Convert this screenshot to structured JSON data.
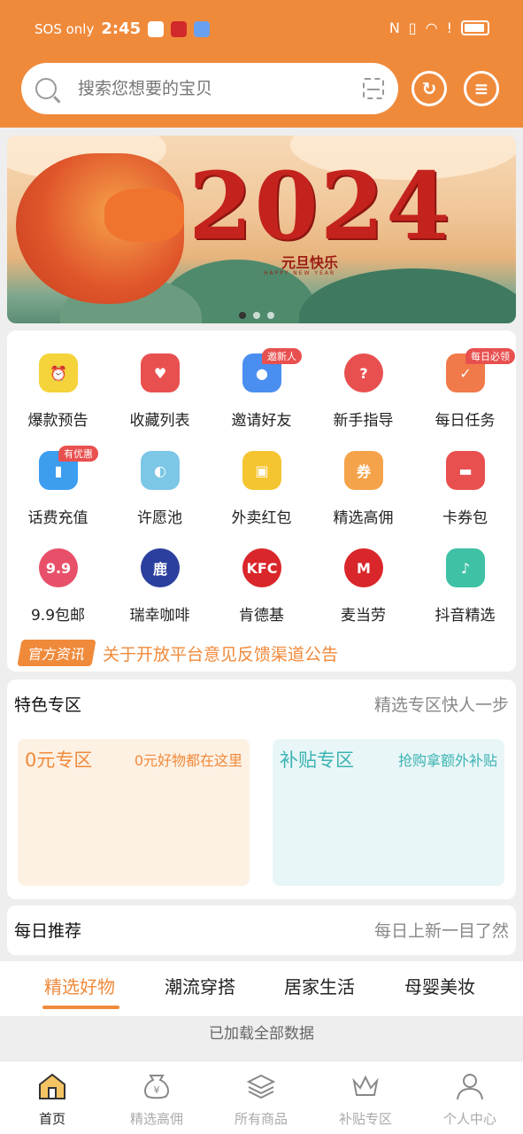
{
  "status_bar": {
    "carrier": "SOS only",
    "time": "2:45"
  },
  "search": {
    "placeholder": "搜索您想要的宝贝"
  },
  "header_icons": [
    "refresh-icon",
    "message-icon"
  ],
  "banner": {
    "year": "2024",
    "subtitle": "元旦快乐",
    "subtitle_en": "HAPPY NEW YEAR",
    "slides": 3,
    "active_slide": 1
  },
  "grid": [
    {
      "label": "爆款预告",
      "icon": "alarm-clock-icon",
      "color": "#f5d33a"
    },
    {
      "label": "收藏列表",
      "icon": "heart-icon",
      "color": "#e8504f"
    },
    {
      "label": "邀请好友",
      "icon": "user-icon",
      "color": "#4a8ef0",
      "badge": "邀新人"
    },
    {
      "label": "新手指导",
      "icon": "question-icon",
      "color": "#e8504f"
    },
    {
      "label": "每日任务",
      "icon": "calendar-check-icon",
      "color": "#f07a4a",
      "badge": "每日必领"
    },
    {
      "label": "话费充值",
      "icon": "phone-icon",
      "color": "#3d9ef0",
      "badge": "有优惠"
    },
    {
      "label": "许愿池",
      "icon": "wish-bottle-icon",
      "color": "#7cc6e6"
    },
    {
      "label": "外卖红包",
      "icon": "delivery-icon",
      "color": "#f5c531"
    },
    {
      "label": "精选高佣",
      "icon": "coupon-icon",
      "color": "#f5a34a"
    },
    {
      "label": "卡券包",
      "icon": "wallet-icon",
      "color": "#e8504f"
    },
    {
      "label": "9.9包邮",
      "icon": "nine-nine-icon",
      "color": "#e8506a"
    },
    {
      "label": "瑞幸咖啡",
      "icon": "luckin-deer-icon",
      "color": "#2b3f9e"
    },
    {
      "label": "肯德基",
      "icon": "kfc-icon",
      "color": "#d9262a"
    },
    {
      "label": "麦当劳",
      "icon": "mcdonalds-icon",
      "color": "#d9262a"
    },
    {
      "label": "抖音精选",
      "icon": "douyin-icon",
      "color": "#3fc1a5"
    }
  ],
  "news": {
    "tag": "官方资讯",
    "text": "关于开放平台意见反馈渠道公告"
  },
  "special": {
    "title": "特色专区",
    "subtitle": "精选专区快人一步",
    "zones": [
      {
        "title": "0元专区",
        "subtitle": "0元好物都在这里",
        "bg": "#fdf1e4",
        "color": "#f08a3b"
      },
      {
        "title": "补贴专区",
        "subtitle": "抢购拿额外补贴",
        "bg": "#e9f6f7",
        "color": "#3bb3b3"
      }
    ]
  },
  "daily": {
    "title": "每日推荐",
    "subtitle": "每日上新一目了然"
  },
  "tabs": [
    "精选好物",
    "潮流穿搭",
    "居家生活",
    "母婴美妆"
  ],
  "loaded_text": "已加载全部数据",
  "bottom_nav": [
    {
      "label": "首页",
      "icon": "home-icon",
      "active": true
    },
    {
      "label": "精选高佣",
      "icon": "money-bag-icon"
    },
    {
      "label": "所有商品",
      "icon": "layers-icon"
    },
    {
      "label": "补贴专区",
      "icon": "crown-icon"
    },
    {
      "label": "个人中心",
      "icon": "person-icon"
    }
  ]
}
